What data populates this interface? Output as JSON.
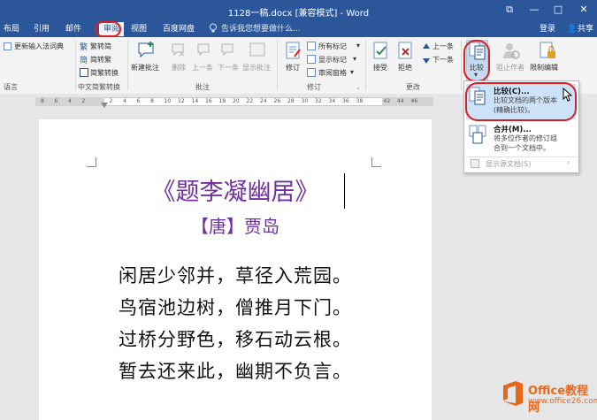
{
  "window": {
    "title": "1128一稿.docx [兼容模式] - Word",
    "restore_glyph": "⧉",
    "minimize_glyph": "—",
    "maximize_glyph": "□",
    "close_glyph": "✕",
    "login": "登录",
    "share": "共享",
    "share_glyph": "👤"
  },
  "tabs": [
    "布局",
    "引用",
    "邮件",
    "审阅",
    "视图",
    "百度网盘"
  ],
  "tell_me": "告诉我您想要做什么...",
  "ribbon": {
    "language": {
      "update_ime": "更新输入法词典",
      "label": "语言"
    },
    "chinese": {
      "trad": "繁转简",
      "simp": "简转繁",
      "convert": "简繁转换",
      "label": "中文简繁转换"
    },
    "comments": {
      "new": "新建批注",
      "delete": "删除",
      "prev": "上一条",
      "next": "下一条",
      "show": "显示批注",
      "label": "批注"
    },
    "tracking": {
      "track": "修订",
      "markup": "所有标记",
      "show_markup": "显示标记",
      "pane": "审阅窗格",
      "label": "修订"
    },
    "changes": {
      "accept": "接受",
      "reject": "拒绝",
      "prev": "上一条",
      "next": "下一条",
      "label": "更改"
    },
    "compare": {
      "label": "比较"
    },
    "protect": {
      "block": "阻止作者",
      "restrict": "限制编辑"
    }
  },
  "ruler": [
    "8",
    "6",
    "4",
    "2",
    "",
    "2",
    "4",
    "6",
    "8",
    "10",
    "12",
    "14",
    "16",
    "18",
    "20",
    "22",
    "24",
    "26",
    "28",
    "30",
    "32",
    "34",
    "36",
    "38",
    "",
    "42",
    "44",
    "46"
  ],
  "document": {
    "title": "《题李凝幽居》",
    "author": "【唐】贾岛",
    "lines": [
      "闲居少邻并，草径入荒园。",
      "鸟宿池边树，僧推月下门。",
      "过桥分野色，移石动云根。",
      "暂去还来此，幽期不负言。"
    ]
  },
  "dropdown": {
    "compare_title": "比较(C)...",
    "compare_desc1": "比较文档的两个版本",
    "compare_desc2": "(精确比较)。",
    "combine_title": "合并(M)...",
    "combine_desc1": "将多位作者的修订组",
    "combine_desc2": "合到一个文档中。",
    "show_source": "显示源文档(S)",
    "chevron": "›"
  },
  "watermark": {
    "brand": "Office教程网",
    "url": "www.office26.com"
  },
  "colors": {
    "title_bar": "#2b579a",
    "accent_red": "#d81f26",
    "poem_purple": "#7030a0",
    "logo_orange": "#e8681a"
  }
}
